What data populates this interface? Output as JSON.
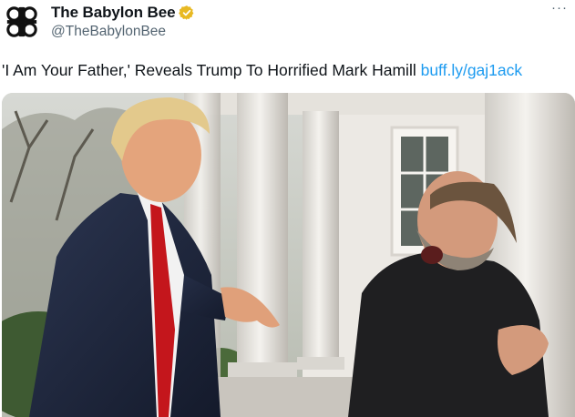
{
  "tweet": {
    "author": {
      "display_name": "The Babylon Bee",
      "handle": "@TheBabylonBee",
      "avatar_icon": "babylon-bee-logo-icon",
      "verified_icon": "verified-badge-icon",
      "verified_color": "#e8b923"
    },
    "more_icon": "more-options-icon",
    "text": "'I Am Your Father,' Reveals Trump To Horrified Mark Hamill",
    "link_text": "buff.ly/gaj1ack",
    "link_color": "#1d9bf0",
    "media": {
      "kind": "photo"
    }
  }
}
